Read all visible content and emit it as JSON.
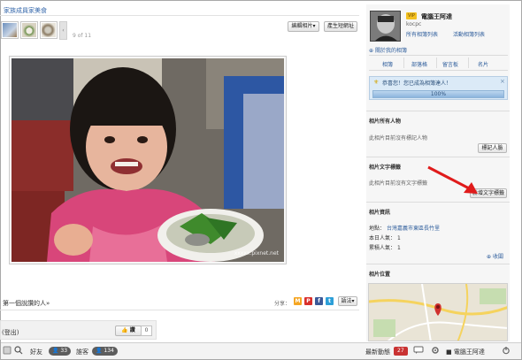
{
  "album": {
    "link_text": "家族成員家美食",
    "counter": "9 of 11",
    "scroll_left_glyph": "‹"
  },
  "toolbar": {
    "edit_label": "編輯相片▾",
    "short_url_label": "產生短網址"
  },
  "photo": {
    "watermark": "xxxxx.pixnet.net"
  },
  "likes": {
    "text": "第一個說讚的人»",
    "share_label": "分享：",
    "lang_label": "語法▾"
  },
  "share_icons": [
    {
      "letter": "M",
      "color": "#f5a623"
    },
    {
      "letter": "P",
      "color": "#d9302c"
    },
    {
      "letter": "f",
      "color": "#3b5998"
    },
    {
      "letter": "t",
      "color": "#2d9fd8"
    },
    {
      "letter": "g",
      "color": "#7cb342"
    }
  ],
  "comment": {
    "login": "(登出)",
    "like_label": "👍 讚",
    "like_count": "0"
  },
  "bottom_bar": {
    "friends": "好友",
    "friends_count": "33",
    "visitors": "誰客",
    "visitors_count": "134",
    "news": "最新動態",
    "news_count": "27",
    "user": "電腦王阿達"
  },
  "owner": {
    "badge": "VIP",
    "name": "電腦王阿達",
    "id": "kocpc",
    "links": [
      "所有相簿列表",
      "活動相簿列表"
    ],
    "about": "關於我的相簿",
    "tabs": [
      "相簿",
      "部落格",
      "留言板",
      "名片"
    ]
  },
  "congrats": {
    "icon": "⚜",
    "text": "恭喜您！您已成為相簿達人！",
    "close": "×",
    "progress_label": "100%",
    "progress_value": 1.0
  },
  "people": {
    "title": "相片所有人物",
    "text": "此相片目前沒有標記人物",
    "button": "標記人臉"
  },
  "text_tags": {
    "title": "相片文字標籤",
    "text": "此相片目前沒有文字標籤",
    "button": "新增文字標籤"
  },
  "info": {
    "title": "相片資訊",
    "rows": [
      {
        "label": "地點：",
        "value": "台灣嘉義市東區長竹里"
      },
      {
        "label": "本日人氣：",
        "value": "1"
      },
      {
        "label": "累積人氣：",
        "value": "1"
      }
    ],
    "collapse": "收闔"
  },
  "location": {
    "title": "相片位置"
  },
  "colors": {
    "link": "#3366aa",
    "accent_red": "#e01b1b",
    "progress_fill": "#9fc3e6"
  }
}
